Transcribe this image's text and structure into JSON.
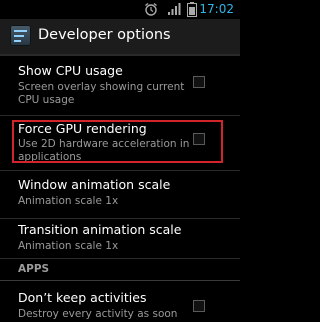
{
  "status_bar": {
    "time": "17:02",
    "icons": [
      "alarm-icon",
      "signal-icon",
      "battery-icon"
    ],
    "accent_color": "#33b5e5"
  },
  "action_bar": {
    "title": "Developer options"
  },
  "preferences": [
    {
      "title": "Show CPU usage",
      "summary": "Screen overlay showing current CPU usage",
      "has_checkbox": true,
      "checked": false
    },
    {
      "title": "Force GPU rendering",
      "summary": "Use 2D hardware acceleration in applications",
      "has_checkbox": true,
      "checked": false,
      "highlighted": true,
      "highlight_color": "#d2242b"
    },
    {
      "title": "Window animation scale",
      "summary": "Animation scale 1x",
      "has_checkbox": false
    },
    {
      "title": "Transition animation scale",
      "summary": "Animation scale 1x",
      "has_checkbox": false
    }
  ],
  "section": {
    "label": "APPS"
  },
  "apps_preferences": [
    {
      "title": "Don’t keep activities",
      "summary": "Destroy every activity as soon",
      "has_checkbox": true,
      "checked": false
    }
  ]
}
